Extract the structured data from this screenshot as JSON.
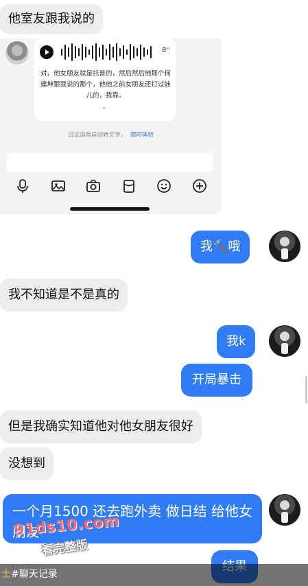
{
  "messages": {
    "m1": "他室友跟我说的",
    "m2": "我🔨哦",
    "m3": "我不知道是不是真的",
    "m4": "我k",
    "m5": "开局暴击",
    "m6": "但是我确实知道他对他女朋友很好",
    "m7": "没想到",
    "m8": "一个月1500 还去跑外卖 做日结 给他女朋友",
    "m9": "结果"
  },
  "embedded_screenshot": {
    "voice_duration": "8''",
    "transcript": "对，他女朋友就是托普的，然后然后他那个何建坤跟我说的那个，他他之前女朋友还打过娃儿的，我靠。",
    "collapse_glyph": "⌃",
    "hint_text": "试试语音自动转文字，",
    "hint_link": "限时体验",
    "toolbar_icons": [
      "microphone-icon",
      "image-icon",
      "camera-icon",
      "red-packet-icon",
      "emoji-icon",
      "plus-icon"
    ]
  },
  "watermark": {
    "site": "91ds10.com",
    "tagline": "看完整版"
  },
  "footer_tag": {
    "prefix": "士",
    "text": "#聊天记录"
  },
  "colors": {
    "right_bubble": "#2f7cf6",
    "left_bubble": "#ededed",
    "watermark_red": "#ff6b6b"
  }
}
